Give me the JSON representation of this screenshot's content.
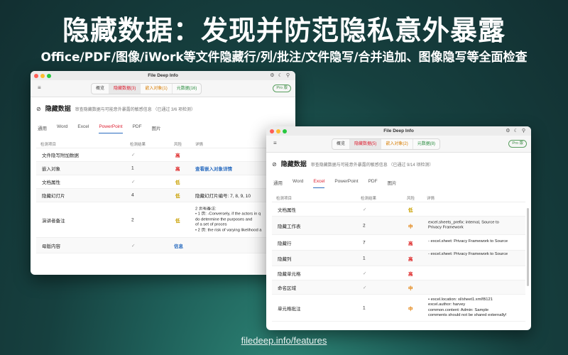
{
  "headline": "隐藏数据：发现并防范隐私意外暴露",
  "subhead": "Office/PDF/图像/iWork等文件隐藏行/列/批注/文件隐写/合并追加、图像隐写等全面检查",
  "footer": "filedeep.info/features",
  "colors": {
    "close": "#ff5f57",
    "minimize": "#febc2e",
    "maximize": "#28c840",
    "accent_red": "#dd2233",
    "accent_blue": "#2a6cc0"
  },
  "icons": {
    "menu": "≡",
    "gear": "⚙",
    "moon": "☾",
    "pin": "⚲",
    "eye_off": "⊘",
    "shield": "⛉",
    "doc": "▤",
    "image": "▨"
  },
  "win1": {
    "title": "File Deep Info",
    "seg": [
      "概览",
      "隐藏数据(3)",
      "嵌入对象(1)",
      "元数据(16)"
    ],
    "pro": "Pro 版",
    "section_title": "隐藏数据",
    "section_desc": "审查隐藏数据与可能意外暴露的敏感信息 （已通过 3/6 项检测）",
    "tabs": [
      "通用",
      "Word",
      "Excel",
      "PowerPoint",
      "PDF",
      "图片"
    ],
    "headers": {
      "item": "检测项目",
      "result": "检测结果",
      "risk": "风险",
      "detail": "详情"
    },
    "rows": [
      {
        "item": "文件隐写附加数据",
        "result": "✓",
        "risk": "高",
        "detail": ""
      },
      {
        "item": "嵌入对象",
        "result": "1",
        "risk": "高",
        "detail": "查看嵌入对象详情"
      },
      {
        "item": "文档属性",
        "result": "✓",
        "risk": "低",
        "detail": ""
      },
      {
        "item": "隐藏幻灯片",
        "result": "4",
        "risk": "低",
        "detail": "隐藏幻灯片编号: 7, 8, 9, 10"
      },
      {
        "item": "演讲者备注",
        "result": "2",
        "risk": "低",
        "detail_lines": [
          "2 页有备注:",
          "• 1 页: -Conversely, if the actors in q",
          "do determine the purposes and",
          "of a set of proces",
          "• 2 页: the risk of varying likelihood a"
        ]
      },
      {
        "item": "母版内容",
        "result": "✓",
        "risk": "信息",
        "detail": ""
      }
    ]
  },
  "win2": {
    "title": "File Deep Info",
    "seg": [
      "概览",
      "隐藏数据(5)",
      "嵌入对象(2)",
      "元数据(8)"
    ],
    "pro": "Pro 版",
    "section_title": "隐藏数据",
    "section_desc": "审查隐藏数据与可能意外暴露的敏感信息 （已通过 9/14 项检测）",
    "tabs": [
      "通用",
      "Word",
      "Excel",
      "PowerPoint",
      "PDF",
      "图片"
    ],
    "headers": {
      "item": "检测项目",
      "result": "检测结果",
      "risk": "风险",
      "detail": "详情"
    },
    "rows": [
      {
        "item": "文档属性",
        "result": "✓",
        "risk": "低",
        "detail": ""
      },
      {
        "item": "隐藏工作表",
        "result": "2",
        "risk": "中",
        "detail_lines": [
          "excel.sheets_prefix: internal, Source to",
          "Privacy Framework"
        ]
      },
      {
        "item": "隐藏行",
        "result": "7",
        "risk": "高",
        "detail_lines": [
          "- excel.sheet: Privacy Framework to Source"
        ]
      },
      {
        "item": "隐藏列",
        "result": "1",
        "risk": "高",
        "detail_lines": [
          "- excel.sheet: Privacy Framework to Source"
        ]
      },
      {
        "item": "隐藏单元格",
        "result": "✓",
        "risk": "高",
        "detail": ""
      },
      {
        "item": "命名区域",
        "result": "✓",
        "risk": "中",
        "detail": ""
      },
      {
        "item": "单元格批注",
        "result": "1",
        "risk": "中",
        "detail_lines": [
          "• excel.location: xl/sheet1.xml!B121",
          "  excel.author: harvey",
          "  common.content: Admin: Sample",
          "  comments should not be shared externally!"
        ]
      }
    ]
  }
}
